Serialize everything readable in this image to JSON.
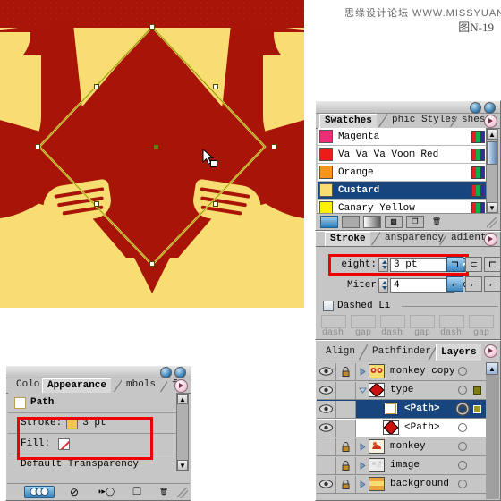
{
  "header": {
    "watermark": "思缘设计论坛 WWW.MISSYUAN.COM",
    "figure_label": "图N-19"
  },
  "artboard": {
    "name": "illustrator-artboard",
    "background_color": "#f8dd72",
    "shape_color": "#a81508",
    "stroke_color": "#e8d44a",
    "anchor_color": "#ffffff",
    "center_point_color": "#6b7a10",
    "cursor": "selection-arrow"
  },
  "swatches_panel": {
    "title": "Swatches",
    "tabs": [
      {
        "label": "Swatches",
        "active": true
      },
      {
        "label": "phic Styles",
        "active": false
      },
      {
        "label": "shes",
        "active": false
      }
    ],
    "swatches": [
      {
        "name": "Magenta",
        "color": "#ec2e78",
        "selected": false
      },
      {
        "name": "Va Va Va Voom Red",
        "color": "#ee1c16",
        "selected": false
      },
      {
        "name": "Orange",
        "color": "#f7941e",
        "selected": false
      },
      {
        "name": "Custard",
        "color": "#f8dd72",
        "selected": true
      },
      {
        "name": "Canary Yellow",
        "color": "#fff200",
        "selected": false
      }
    ],
    "footer_icons": [
      {
        "name": "show-all-swatches-icon",
        "glyph": "",
        "active": true
      },
      {
        "name": "show-color-swatches-icon",
        "glyph": "",
        "active": false
      },
      {
        "name": "show-gradient-swatches-icon",
        "glyph": "",
        "active": false
      },
      {
        "name": "show-pattern-swatches-icon",
        "glyph": "▩",
        "active": false
      },
      {
        "name": "new-swatch-icon",
        "glyph": "❐",
        "active": false
      },
      {
        "name": "delete-swatch-icon",
        "glyph": "🗑",
        "active": false
      }
    ],
    "scroll_up": "▲",
    "scroll_down": "▼"
  },
  "stroke_panel": {
    "tabs": [
      {
        "label": "Stroke",
        "active": true
      },
      {
        "label": "ansparency",
        "active": false
      },
      {
        "label": "adient",
        "active": false
      }
    ],
    "weight_label": "eight:",
    "weight_value": "3 pt",
    "miter_label": "Miter",
    "miter_value": "4",
    "miter_unit": "x",
    "dashed_label": "Dashed Li",
    "dashed_checked": false,
    "dash_labels": [
      "dash",
      "gap",
      "dash",
      "gap",
      "dash",
      "gap"
    ],
    "cap_buttons": [
      {
        "name": "butt-cap-button",
        "selected": true
      },
      {
        "name": "round-cap-button",
        "selected": false
      },
      {
        "name": "projecting-cap-button",
        "selected": false
      }
    ],
    "join_buttons": [
      {
        "name": "miter-join-button",
        "selected": true
      },
      {
        "name": "round-join-button",
        "selected": false
      },
      {
        "name": "bevel-join-button",
        "selected": false
      }
    ],
    "highlight_color": "#ef0000"
  },
  "layers_panel": {
    "tabs": [
      {
        "label": "Align",
        "active": false
      },
      {
        "label": "Pathfinder",
        "active": false
      },
      {
        "label": "Layers",
        "active": true
      }
    ],
    "rows": [
      {
        "name": "monkey copy",
        "visible": true,
        "locked": true,
        "expandable": true,
        "indent": 0,
        "selected": false,
        "thumb": "monkey",
        "target_active": false,
        "has_square": false
      },
      {
        "name": "type",
        "visible": true,
        "locked": false,
        "expanded": true,
        "indent": 0,
        "selected": false,
        "thumb": "diamond",
        "target_active": false,
        "has_square": true
      },
      {
        "name": "<Path>",
        "visible": true,
        "locked": false,
        "expandable": false,
        "indent": 1,
        "selected": true,
        "thumb": "empty",
        "target_active": true,
        "has_square": true
      },
      {
        "name": "<Path>",
        "visible": true,
        "locked": false,
        "expandable": false,
        "indent": 1,
        "selected": false,
        "thumb": "diamond",
        "target_active": false,
        "has_square": false
      },
      {
        "name": "monkey",
        "visible": false,
        "locked": true,
        "expandable": true,
        "indent": 0,
        "selected": false,
        "thumb": "monkey",
        "target_active": false,
        "has_square": false
      },
      {
        "name": "image",
        "visible": false,
        "locked": true,
        "expandable": true,
        "indent": 0,
        "selected": false,
        "thumb": "image",
        "target_active": false,
        "has_square": false
      },
      {
        "name": "background",
        "visible": true,
        "locked": true,
        "expandable": true,
        "indent": 0,
        "selected": false,
        "thumb": "bg",
        "target_active": false,
        "has_square": false
      }
    ],
    "selection_color": "#17457e"
  },
  "appearance_panel": {
    "tabs": [
      {
        "label": "Colo",
        "active": false
      },
      {
        "label": "Appearance",
        "active": true
      },
      {
        "label": "mbols",
        "active": false
      },
      {
        "label": "fo",
        "active": false
      }
    ],
    "rows": [
      {
        "label": "Path",
        "type": "title",
        "chip": "#ffffff"
      },
      {
        "label": "Stroke:",
        "type": "stroke",
        "chip": "#f3c64b",
        "value": "3 pt"
      },
      {
        "label": "Fill:",
        "type": "fill",
        "chip": "none",
        "value": ""
      },
      {
        "label": "Default Transparency",
        "type": "text"
      }
    ],
    "footer_icons": [
      {
        "name": "appearance-toggle-icon",
        "active": true
      },
      {
        "name": "clear-appearance-icon",
        "glyph": "⊘",
        "active": false
      },
      {
        "name": "reduce-to-basic-appearance-icon",
        "glyph": "◑▸◯",
        "active": false
      },
      {
        "name": "duplicate-item-icon",
        "glyph": "❐",
        "active": false
      },
      {
        "name": "delete-item-icon",
        "glyph": "🗑",
        "active": false
      }
    ],
    "highlight_color": "#ef0000"
  }
}
